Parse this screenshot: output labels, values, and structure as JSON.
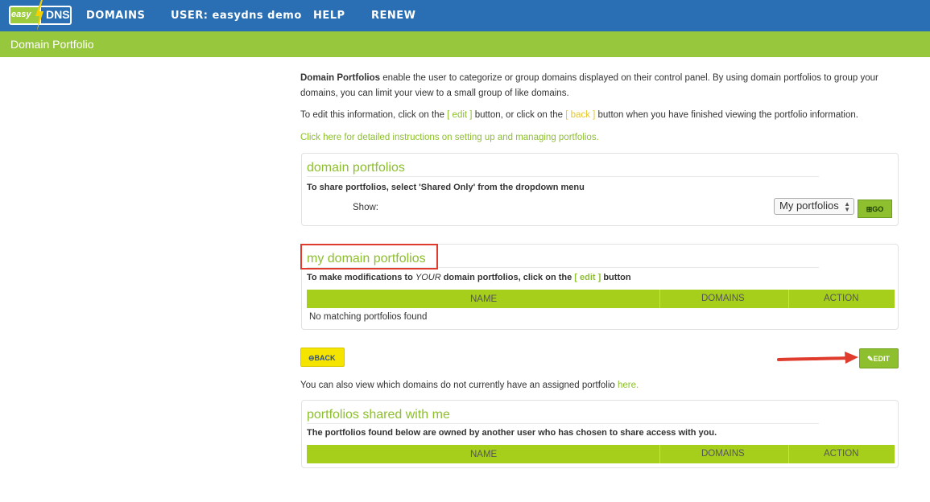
{
  "logo": {
    "part1": "easy",
    "part2": "DNS"
  },
  "nav": {
    "items": [
      {
        "label": "DOMAINS"
      },
      {
        "label": "USER: easydns demo"
      },
      {
        "label": "HELP"
      },
      {
        "label": "RENEW"
      }
    ]
  },
  "page": {
    "title": "Domain Portfolio"
  },
  "intro": {
    "bold_lead": "Domain Portfolios",
    "line1_rest": " enable the user to categorize or group domains displayed on their control panel. By using domain portfolios to group your",
    "line2": "domains, you can limit your view to a small group of like domains.",
    "edit_prefix": "To edit this information, click on the ",
    "edit_link": "[ edit ]",
    "edit_middle": " button, or click on the ",
    "back_link": "[ back ]",
    "edit_suffix": " button when you have finished viewing the portfolio information.",
    "instructions_link": "Click here for detailed instructions on setting up and managing portfolios."
  },
  "panel_portfolios": {
    "title": "domain portfolios",
    "subtitle": "To share portfolios, select 'Shared Only' from the dropdown menu",
    "show_label": "Show:",
    "select_value": "My portfolios",
    "go_label": "GO"
  },
  "panel_my": {
    "title": "my domain portfolios",
    "subtitle_prefix": "To make modifications to ",
    "subtitle_em": "YOUR",
    "subtitle_middle": " domain portfolios, click on the ",
    "subtitle_link": "[ edit ]",
    "subtitle_suffix": " button",
    "columns": [
      "NAME",
      "DOMAINS",
      "ACTION"
    ],
    "empty_message": "No matching portfolios found"
  },
  "buttons": {
    "back_label": "BACK",
    "edit_label": "EDIT"
  },
  "unassigned": {
    "text": "You can also view which domains do not currently have an assigned portfolio ",
    "link": "here."
  },
  "panel_shared": {
    "title": "portfolios shared with me",
    "subtitle": "The portfolios found below are owned by another user who has chosen to share access with you.",
    "columns": [
      "NAME",
      "DOMAINS",
      "ACTION"
    ]
  },
  "colors": {
    "nav_blue": "#2a6fb3",
    "brand_green": "#97c73d",
    "table_header_green": "#a6cf1b",
    "back_yellow": "#f5e400",
    "annotation_red": "#e03c2e"
  }
}
